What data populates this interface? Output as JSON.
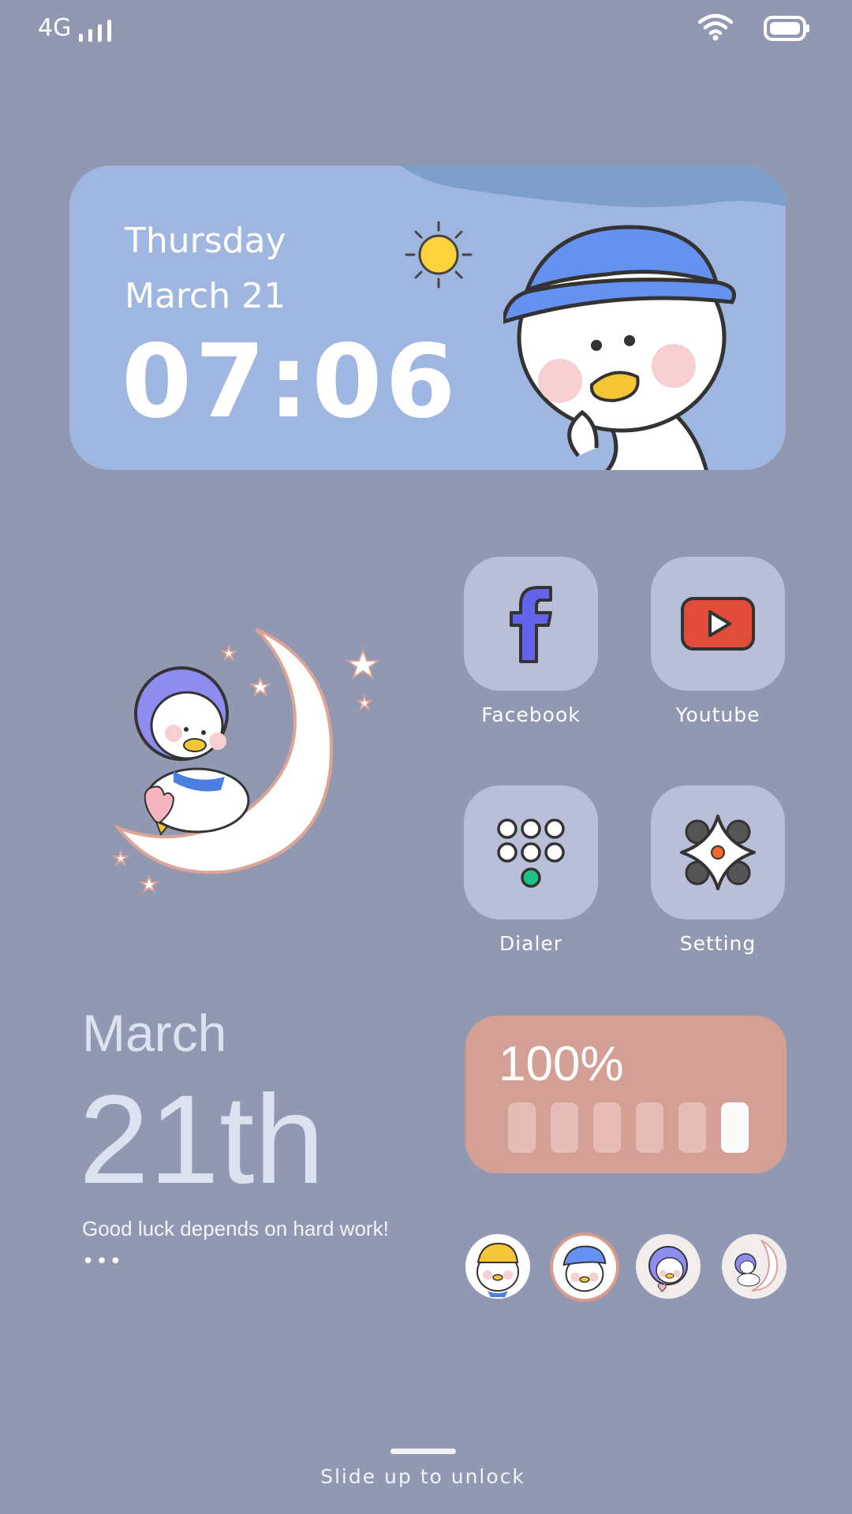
{
  "status_bar": {
    "network": "4G",
    "signal_level": 4,
    "wifi": "wifi-icon",
    "battery": "battery-icon"
  },
  "time_card": {
    "weekday": "Thursday",
    "date": "March 21",
    "time": "07:06",
    "weather_icon": "sun-icon",
    "illustration": "duck-with-blue-hat"
  },
  "illustration": "duck-on-moon",
  "apps": [
    {
      "label": "Facebook",
      "icon": "facebook-icon"
    },
    {
      "label": "Youtube",
      "icon": "youtube-icon"
    },
    {
      "label": "Dialer",
      "icon": "dialer-icon"
    },
    {
      "label": "Setting",
      "icon": "setting-icon"
    }
  ],
  "date_widget": {
    "month": "March",
    "day": "21th",
    "motto": "Good luck depends on hard work!",
    "more": "•••"
  },
  "battery_widget": {
    "percent_label": "100%",
    "level": 1.0,
    "cells": 6
  },
  "avatars": [
    "duck-yellow-hat",
    "duck-blue-hat",
    "duck-purple-hood",
    "duck-on-moon"
  ],
  "unlock": {
    "text": "Slide up to unlock"
  },
  "colors": {
    "background": "#9199b2",
    "card": "#9fb6e0",
    "tile": "#b9bfd9",
    "battery_widget": "#d49f95",
    "facebook": "#6363ee",
    "youtube": "#e04b3a",
    "dialer_accent": "#1fc18a"
  }
}
